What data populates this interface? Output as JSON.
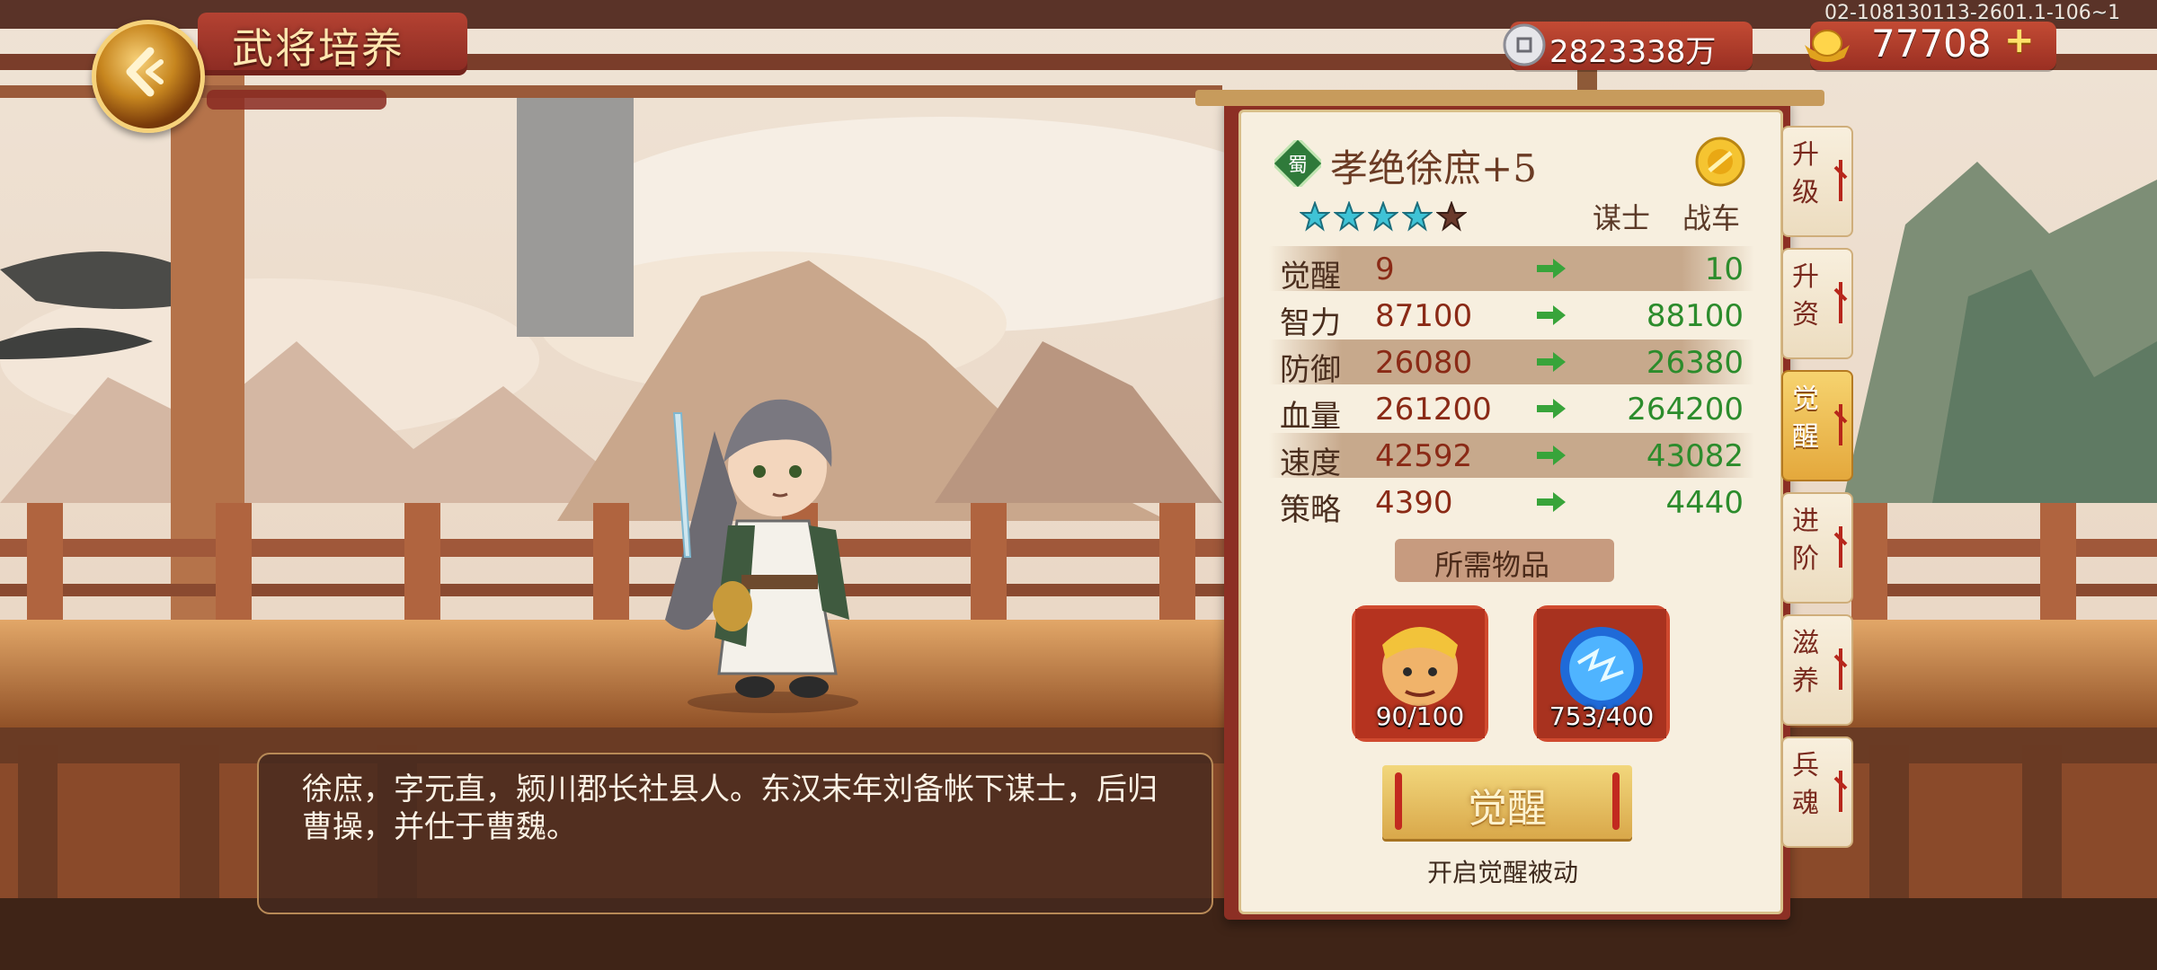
{
  "header": {
    "title": "武将培养",
    "build_tag": "02-108130113-2601.1-106~1",
    "silver": "2823338万",
    "gold": "77708",
    "plus_label": "+"
  },
  "hero": {
    "name": "孝绝徐庶+5",
    "faction": "蜀",
    "stars_filled": 4,
    "stars_total": 5,
    "role": "谋士",
    "unit_type": "战车"
  },
  "stats": [
    {
      "name": "觉醒",
      "current": "9",
      "next": "10"
    },
    {
      "name": "智力",
      "current": "87100",
      "next": "88100"
    },
    {
      "name": "防御",
      "current": "26080",
      "next": "26380"
    },
    {
      "name": "血量",
      "current": "261200",
      "next": "264200"
    },
    {
      "name": "速度",
      "current": "42592",
      "next": "43082"
    },
    {
      "name": "策略",
      "current": "4390",
      "next": "4440"
    }
  ],
  "required": {
    "title": "所需物品",
    "items": [
      {
        "icon": "hero-portrait-icon",
        "count": "90/100"
      },
      {
        "icon": "blue-orb-icon",
        "count": "753/400"
      }
    ]
  },
  "awaken_button": "觉醒",
  "awaken_hint": "开启觉醒被动",
  "description": "徐庶，字元直，颍川郡长社县人。东汉末年刘备帐下谋士，后归曹操，并仕于曹魏。",
  "side_tabs": [
    {
      "label": "升级",
      "active": false
    },
    {
      "label": "升资",
      "active": false
    },
    {
      "label": "觉醒",
      "active": true
    },
    {
      "label": "进阶",
      "active": false
    },
    {
      "label": "滋养",
      "active": false
    },
    {
      "label": "兵魂",
      "active": false
    }
  ],
  "colors": {
    "frame": "#8c2f24",
    "increase": "#2c8c2c",
    "current_value": "#8a2a16"
  }
}
